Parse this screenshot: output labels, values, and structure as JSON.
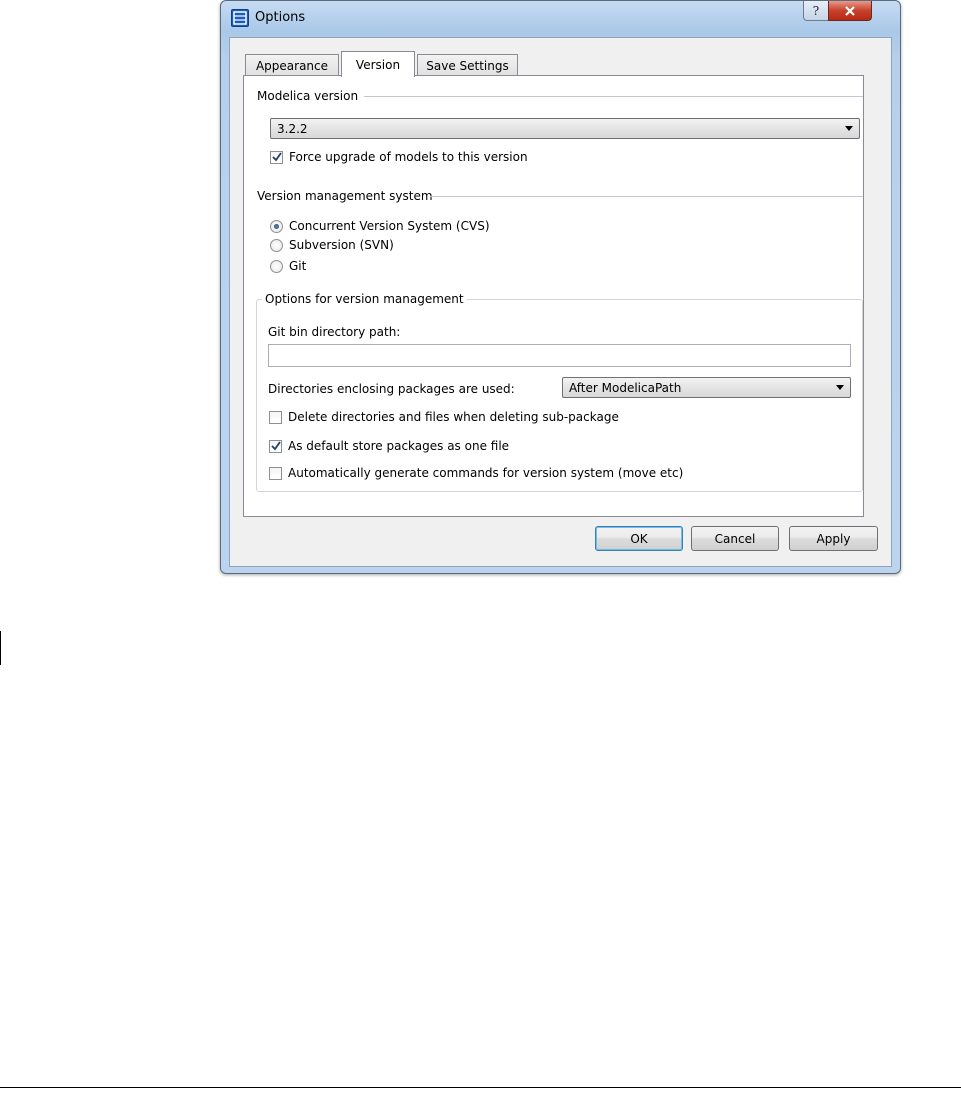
{
  "window": {
    "title": "Options",
    "help_glyph": "?"
  },
  "tabs": [
    {
      "label": "Appearance",
      "active": false
    },
    {
      "label": "Version",
      "active": true
    },
    {
      "label": "Save Settings",
      "active": false
    }
  ],
  "modelica": {
    "group_title": "Modelica version",
    "version_value": "3.2.2",
    "force_upgrade": {
      "label": "Force upgrade of models to this version",
      "checked": true
    }
  },
  "vms": {
    "group_title": "Version management system",
    "options": [
      {
        "label": "Concurrent Version System (CVS)",
        "selected": true
      },
      {
        "label": "Subversion (SVN)",
        "selected": false
      },
      {
        "label": "Git",
        "selected": false
      }
    ]
  },
  "vm_options": {
    "group_title": "Options for version management",
    "git_path_label": "Git bin directory path:",
    "git_path_value": "",
    "dirs_label": "Directories enclosing packages are used:",
    "dirs_value": "After ModelicaPath",
    "delete_dirs": {
      "label": "Delete directories and files when deleting sub-package",
      "checked": false
    },
    "store_one_file": {
      "label": "As default store packages as one file",
      "checked": true
    },
    "auto_commands": {
      "label": "Automatically generate commands for version system (move etc)",
      "checked": false
    }
  },
  "buttons": {
    "ok": "OK",
    "cancel": "Cancel",
    "apply": "Apply"
  },
  "colors": {
    "accent": "#1d5fbf",
    "close_red": "#c7412b",
    "default_button_border": "#3c7fb1"
  }
}
